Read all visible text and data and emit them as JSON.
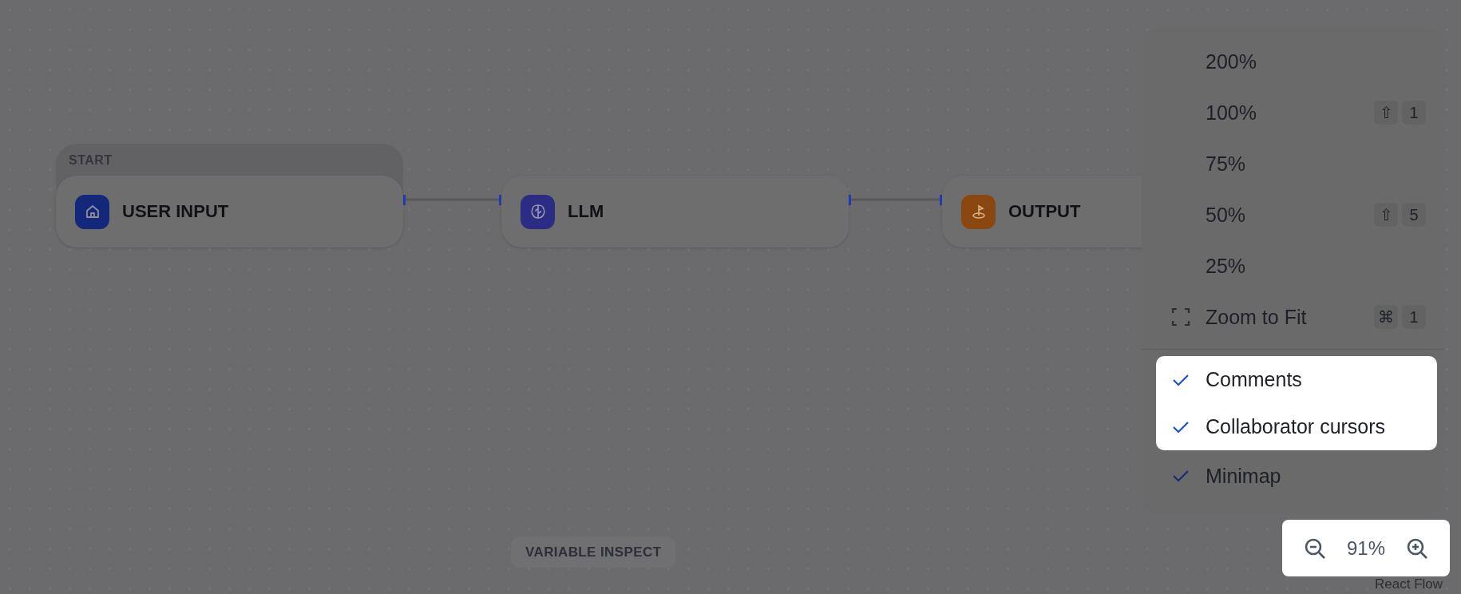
{
  "canvas": {
    "group": {
      "label": "START"
    },
    "nodes": [
      {
        "title": "USER INPUT",
        "color": "#13287a",
        "kind": "start"
      },
      {
        "title": "LLM",
        "color": "#2b2d85",
        "kind": "llm"
      },
      {
        "title": "OUTPUT",
        "color": "#8a4810",
        "kind": "end"
      }
    ],
    "variable_inspect": "VARIABLE INSPECT",
    "attribution": "React Flow"
  },
  "zoom_menu": {
    "items": [
      {
        "kind": "zoom",
        "label": "200%",
        "highlighted": false
      },
      {
        "kind": "zoom",
        "label": "100%",
        "keys": [
          "⇧",
          "1"
        ],
        "highlighted": false
      },
      {
        "kind": "zoom",
        "label": "75%",
        "highlighted": false
      },
      {
        "kind": "zoom",
        "label": "50%",
        "keys": [
          "⇧",
          "5"
        ],
        "highlighted": false
      },
      {
        "kind": "zoom",
        "label": "25%",
        "highlighted": false
      },
      {
        "kind": "fit",
        "label": "Zoom to Fit",
        "keys": [
          "⌘",
          "1"
        ],
        "highlighted": false
      },
      {
        "kind": "toggle",
        "label": "Comments",
        "checked": true,
        "highlighted": true
      },
      {
        "kind": "toggle",
        "label": "Collaborator cursors",
        "checked": true,
        "highlighted": true
      },
      {
        "kind": "toggle",
        "label": "Minimap",
        "checked": true,
        "highlighted": false
      }
    ]
  },
  "zoom_control": {
    "value": "91%"
  }
}
